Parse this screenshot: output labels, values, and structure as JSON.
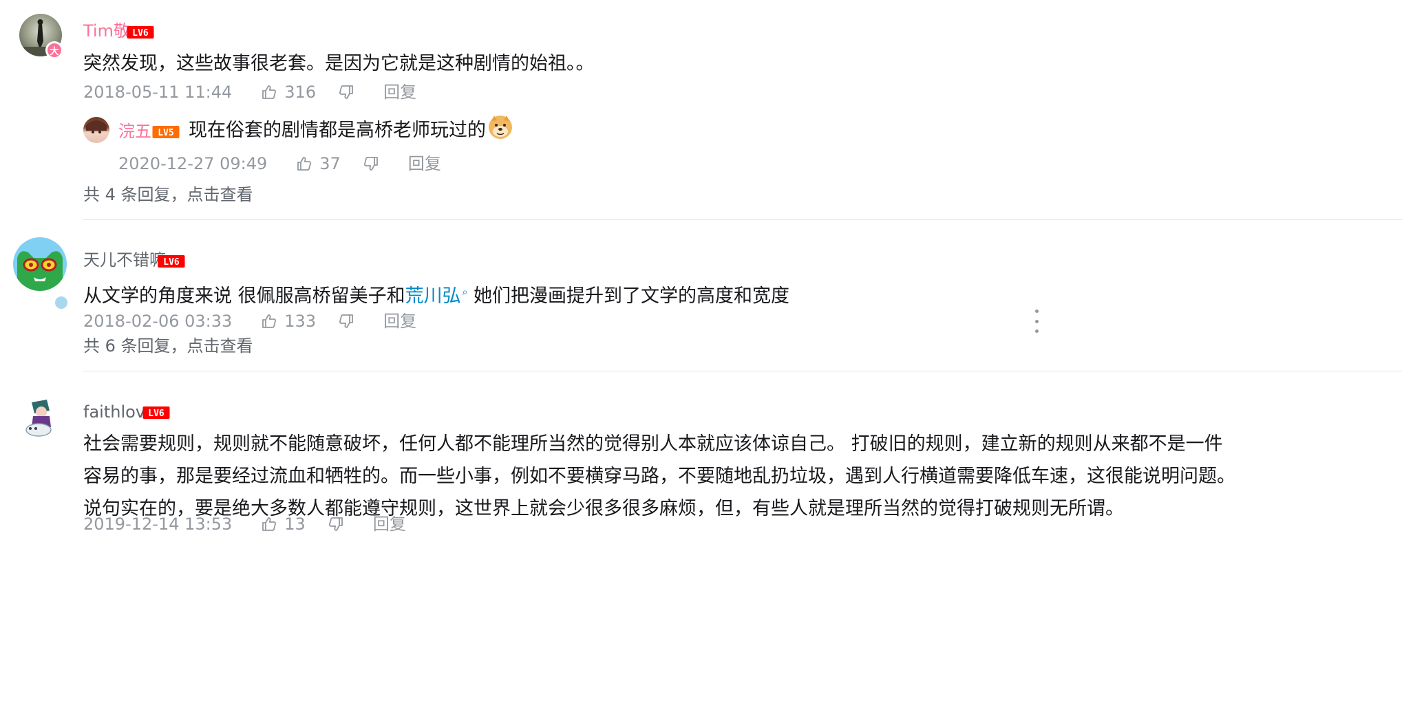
{
  "comments": [
    {
      "user": "Tim敬",
      "level": "LV6",
      "badge": "大",
      "content": "突然发现，这些故事很老套。是因为它就是这种剧情的始祖。。",
      "time": "2018-05-11 11:44",
      "likes": "316",
      "reply_label": "回复",
      "sub_reply": {
        "user": "浣五",
        "level": "LV5",
        "content": "现在俗套的剧情都是高桥老师玩过的",
        "emoji": "doge-icon",
        "time": "2020-12-27 09:49",
        "likes": "37",
        "reply_label": "回复"
      },
      "view_more": "共 4 条回复，点击查看"
    },
    {
      "user": "天儿不错嘛",
      "level": "LV6",
      "content_before": "从文学的角度来说 很佩服高桥留美子和",
      "content_link": "荒川弘",
      "content_after": " 她们把漫画提升到了文学的高度和宽度",
      "time": "2018-02-06 03:33",
      "likes": "133",
      "reply_label": "回复",
      "view_more": "共 6 条回复，点击查看"
    },
    {
      "user": "faithlove",
      "level": "LV6",
      "content_lines": [
        "社会需要规则，规则就不能随意破坏，任何人都不能理所当然的觉得别人本就应该体谅自己。 打破旧的规则，建立新的规则从来都不是一件",
        "容易的事，那是要经过流血和牺牲的。而一些小事，例如不要横穿马路，不要随地乱扔垃圾，遇到人行横道需要降低车速，这很能说明问题。",
        "说句实在的，要是绝大多数人都能遵守规则，这世界上就会少很多很多麻烦，但，有些人就是理所当然的觉得打破规则无所谓。"
      ],
      "time": "2019-12-14 13:53",
      "likes": "13",
      "reply_label": "回复"
    }
  ],
  "colors": {
    "vip_name": "#fb7299",
    "normal_name": "#61666d",
    "lv6": "#ff0000",
    "lv5": "#ff6c00",
    "meta": "#9499a0",
    "link": "#008ac5"
  }
}
